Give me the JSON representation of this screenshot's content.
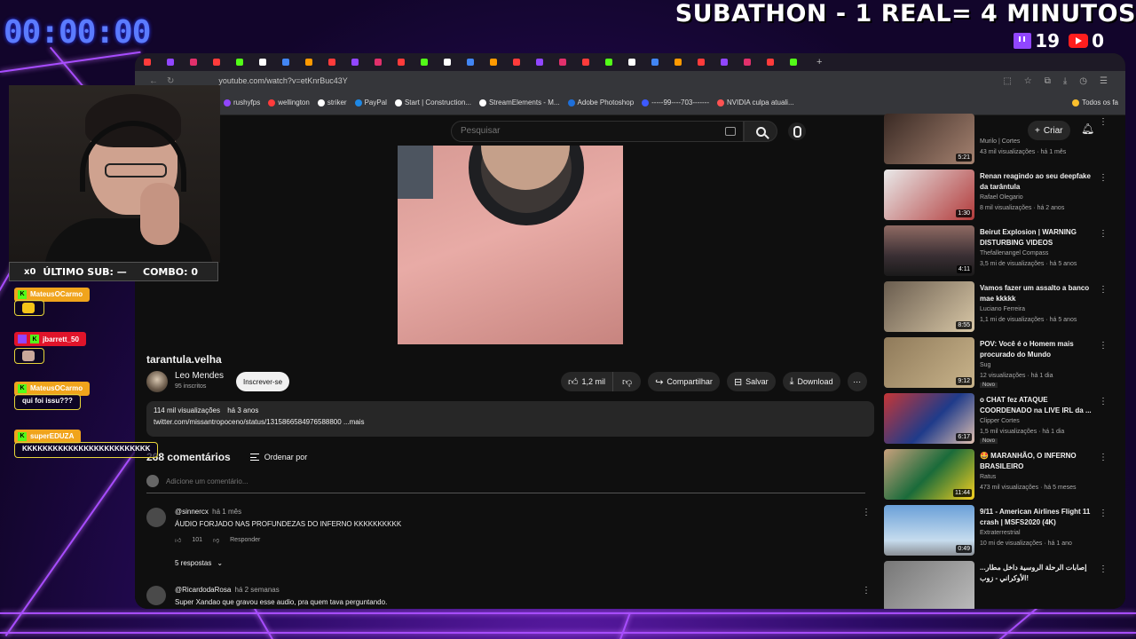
{
  "overlay": {
    "timer": "00:00:00",
    "subathon": "SUBATHON - 1 REAL= 4 MINUTOS",
    "twitch_count": "19",
    "youtube_count": "0",
    "sub_bar": {
      "multiplier": "x0",
      "last_sub": "ÚLTIMO SUB: —",
      "combo": "COMBO: 0"
    },
    "chat": [
      {
        "user": "MateusOCarmo",
        "platform": "kick",
        "color": "#f0a41c",
        "message": ""
      },
      {
        "user": "jbarrett_50",
        "platform": "twitch",
        "color": "#e0142a",
        "message": ""
      },
      {
        "user": "MateusOCarmo",
        "platform": "kick",
        "color": "#f0a41c",
        "message": "qui foi issu???"
      },
      {
        "user": "superEDUZA",
        "platform": "kick",
        "color": "#f0a41c",
        "message": "KKKKKKKKKKKKKKKKKKKKKKKKK"
      }
    ]
  },
  "browser": {
    "url": "youtube.com/watch?v=etKnrBuc43Y",
    "tab_count": 29,
    "bookmarks": [
      "rushyfps",
      "wellington",
      "striker",
      "PayPal",
      "Start | Construction...",
      "StreamElements - M...",
      "Adobe Photoshop",
      "-----99----703-------",
      "NVIDIA culpa atuali...",
      "Todos os fa"
    ]
  },
  "youtube": {
    "search_placeholder": "Pesquisar",
    "create_label": "Criar",
    "video_title": "tarantula.velha",
    "channel_name": "Leo Mendes",
    "channel_subs": "95 inscritos",
    "subscribe_label": "Inscrever-se",
    "likes": "1,2 mil",
    "share_label": "Compartilhar",
    "save_label": "Salvar",
    "download_label": "Download",
    "description": {
      "views": "114 mil visualizações",
      "age": "há 3 anos",
      "link": "twitter.com/missantropoceno/status/1315866584976588800",
      "more": "...mais"
    },
    "comments_count": "268 comentários",
    "sort_label": "Ordenar por",
    "add_comment_placeholder": "Adicione um comentário...",
    "comments": [
      {
        "author": "@sinnercx",
        "time": "há 1 mês",
        "text": "ÁUDIO FORJADO NAS PROFUNDEZAS DO INFERNO KKKKKKKKKK",
        "likes": "101",
        "reply": "Responder",
        "replies": "5 respostas"
      },
      {
        "author": "@RicardodaRosa",
        "time": "há 2 semanas",
        "text": "Super Xandao que gravou esse audio, pra quem tava perguntando.",
        "likes": "",
        "reply": "",
        "replies": ""
      }
    ],
    "recommendations": [
      {
        "title": "",
        "channel": "Murilo | Cortes",
        "meta": "43 mil visualizações · há 1 mês",
        "duration": "5:21",
        "badge": ""
      },
      {
        "title": "Renan reagindo ao seu deepfake da tarântula",
        "channel": "Rafael Olegario",
        "meta": "8 mil visualizações · há 2 anos",
        "duration": "1:30",
        "badge": ""
      },
      {
        "title": "Beirut Explosion | WARNING DISTURBING VIDEOS",
        "channel": "Thefallenangel Compass",
        "meta": "3,5 mi de visualizações · há 5 anos",
        "duration": "4:11",
        "badge": ""
      },
      {
        "title": "Vamos fazer um assalto a banco mae kkkkk",
        "channel": "Luciano Ferreira",
        "meta": "1,1 mi de visualizações · há 5 anos",
        "duration": "8:55",
        "badge": ""
      },
      {
        "title": "POV: Você é o Homem mais procurado do Mundo",
        "channel": "Sug",
        "meta": "12 visualizações · há 1 dia",
        "duration": "9:12",
        "badge": "Novo"
      },
      {
        "title": "o CHAT fez ATAQUE COORDENADO na LIVE IRL da ...",
        "channel": "Clipper Cortes",
        "meta": "1,5 mil visualizações · há 1 dia",
        "duration": "6:17",
        "badge": "Novo"
      },
      {
        "title": "🤩 MARANHÃO, O INFERNO BRASILEIRO",
        "channel": "Ratus",
        "meta": "473 mil visualizações · há 5 meses",
        "duration": "11:44",
        "badge": ""
      },
      {
        "title": "9/11 - American Airlines Flight 11 crash | MSFS2020 (4K)",
        "channel": "Extraterrestrial",
        "meta": "10 mi de visualizações · há 1 ano",
        "duration": "0:49",
        "badge": ""
      },
      {
        "title": "إصابات الرحلة الروسية داخل مطار... الأوكراني - زوب!",
        "channel": "",
        "meta": "",
        "duration": "",
        "badge": ""
      }
    ]
  },
  "colors": {
    "timer": "#5b7bff",
    "accent_purple": "#9146ff",
    "youtube_red": "#ff1e1e",
    "kick_green": "#53fc18",
    "chat_border": "#e8d53a"
  }
}
